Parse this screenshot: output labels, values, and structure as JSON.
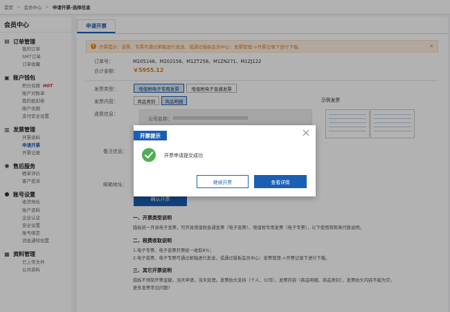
{
  "breadcrumb": {
    "home": "首页",
    "member": "会员中心",
    "current": "申请开票-选择信息"
  },
  "sidebar": {
    "title": "会员中心",
    "groups": [
      {
        "title": "订单管理",
        "icon": "order-icon",
        "items": [
          "我的订单",
          "SMT订单",
          "订单收藏"
        ]
      },
      {
        "title": "账户钱包",
        "icon": "wallet-icon",
        "items": [
          "积分兑换",
          "账户对账单",
          "我的抵扣券",
          "账户余额",
          "支付安全设置"
        ],
        "hot": "HOT"
      },
      {
        "title": "发票管理",
        "icon": "invoice-icon",
        "items": [
          "开票资料",
          "申请开票",
          "开票记录"
        ]
      },
      {
        "title": "售后服务",
        "icon": "service-icon",
        "items": [
          "晒单评价",
          "客户投诉"
        ]
      },
      {
        "title": "账号设置",
        "icon": "user-icon",
        "items": [
          "收货地址",
          "账户资料",
          "企业认证",
          "安全设置",
          "账号绑定",
          "消息通知设置"
        ]
      },
      {
        "title": "资料管理",
        "icon": "folder-icon",
        "items": [
          "已上传文件",
          "公共资料"
        ]
      }
    ]
  },
  "main": {
    "tab": "申请开票",
    "notice": "开票提示：普票、专票可通过邮箱进行发送，或通过猎板会员中心：发票管理->开票记录下进行下载。",
    "order_label": "订单号：",
    "order_value": "M205146、M202156、M1ZT258、M1ZN271、M1ZJ122",
    "total_label": "合计金额：",
    "total_value": "￥5955.12",
    "type_label": "发票类型：",
    "type_options": [
      "增值税电子专用发票",
      "增值税电子普通发票"
    ],
    "content_label": "发票内容：",
    "content_options": [
      "商品类别",
      "商品明细"
    ],
    "info_label": "递质信息：",
    "company_label": "公司名称：",
    "remark_label": "备注信息：",
    "email_label": "邮箱地址：",
    "sample_label": "示例发票",
    "submit": "确认开票",
    "sec1_title": "一、开票类型说明",
    "sec1_text": "猎板统一开具电子发票，可开具增值税普通发票（电子普票）、增值税专用发票（电子专票），以下使用简称来代替说明。",
    "sec2_title": "二、税费收取说明",
    "sec2_line1": "1.电子专票、电子普票开票统一收取8%；",
    "sec2_line2": "2.电子普票、电子专票可通过邮箱进行发送，或通过猎板会员中心：发票管理->开票记录下进行下载。",
    "sec3_title": "三、其它开票说明",
    "sec3_line1": "猎板不预制开票金额，当天申请，当天处理。发票抬头支持（个人、公司），发票内容（商品明细、商品类别），发票抬头内容不能为空。",
    "sec3_line2": "更多发票常见问题?"
  },
  "modal": {
    "title": "开票提示",
    "message": "开票申请提交成功",
    "continue": "继续开票",
    "details": "查看详情"
  },
  "colors": {
    "primary": "#1a5fb4",
    "accent": "#e07b1a",
    "success": "#4caf50",
    "hot": "#e02020"
  }
}
